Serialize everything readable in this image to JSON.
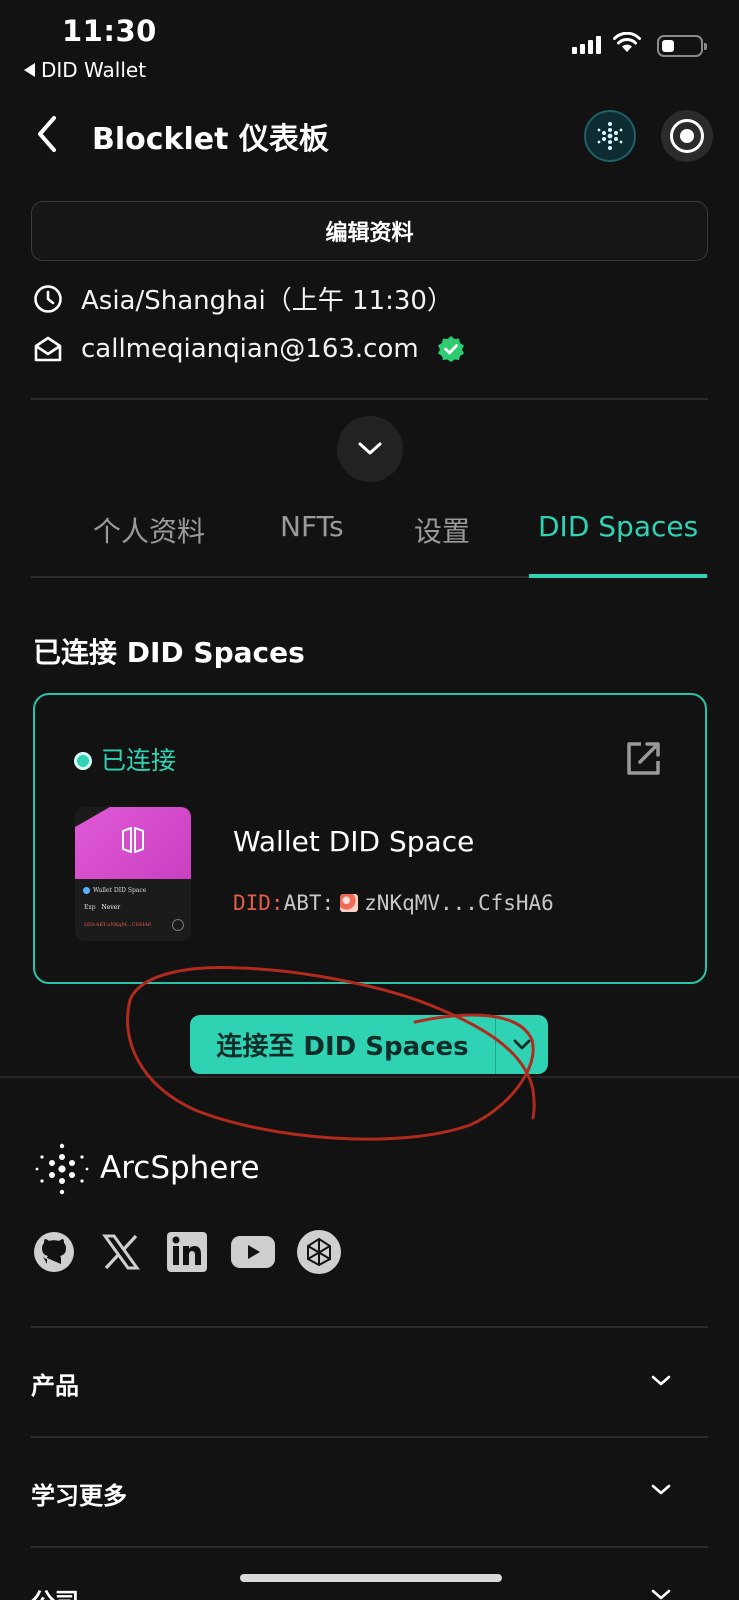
{
  "status_bar": {
    "time": "11:30",
    "back_app": "DID Wallet"
  },
  "header": {
    "title": "Blocklet 仪表板"
  },
  "profile": {
    "edit_button": "编辑资料",
    "timezone": "Asia/Shanghai（上午 11:30）",
    "email": "callmeqianqian@163.com"
  },
  "tabs": [
    {
      "label": "个人资料",
      "active": false
    },
    {
      "label": "NFTs",
      "active": false
    },
    {
      "label": "设置",
      "active": false
    },
    {
      "label": "DID Spaces",
      "active": true
    }
  ],
  "did_spaces": {
    "section_title": "已连接 DID Spaces",
    "status": "已连接",
    "space_name": "Wallet DID Space",
    "did_prefix": "DID:",
    "did_value": "ABT:",
    "did_short": "zNKqMV...CfsHA6",
    "thumb": {
      "title": "Wallet DID Space",
      "exp_label": "Exp",
      "exp_value": "Never",
      "did_mini": "DID:ABT:zNKqM...CfsHA6"
    },
    "connect_button": "连接至 DID Spaces"
  },
  "footer": {
    "brand": "ArcSphere",
    "social": [
      "github-icon",
      "x-icon",
      "linkedin-icon",
      "youtube-icon",
      "arcblock-icon"
    ],
    "sections": [
      {
        "label": "产品"
      },
      {
        "label": "学习更多"
      },
      {
        "label": "公司"
      }
    ]
  },
  "colors": {
    "accent": "#2fd3b4",
    "background": "#121212",
    "annotation": "#b02a1e"
  }
}
